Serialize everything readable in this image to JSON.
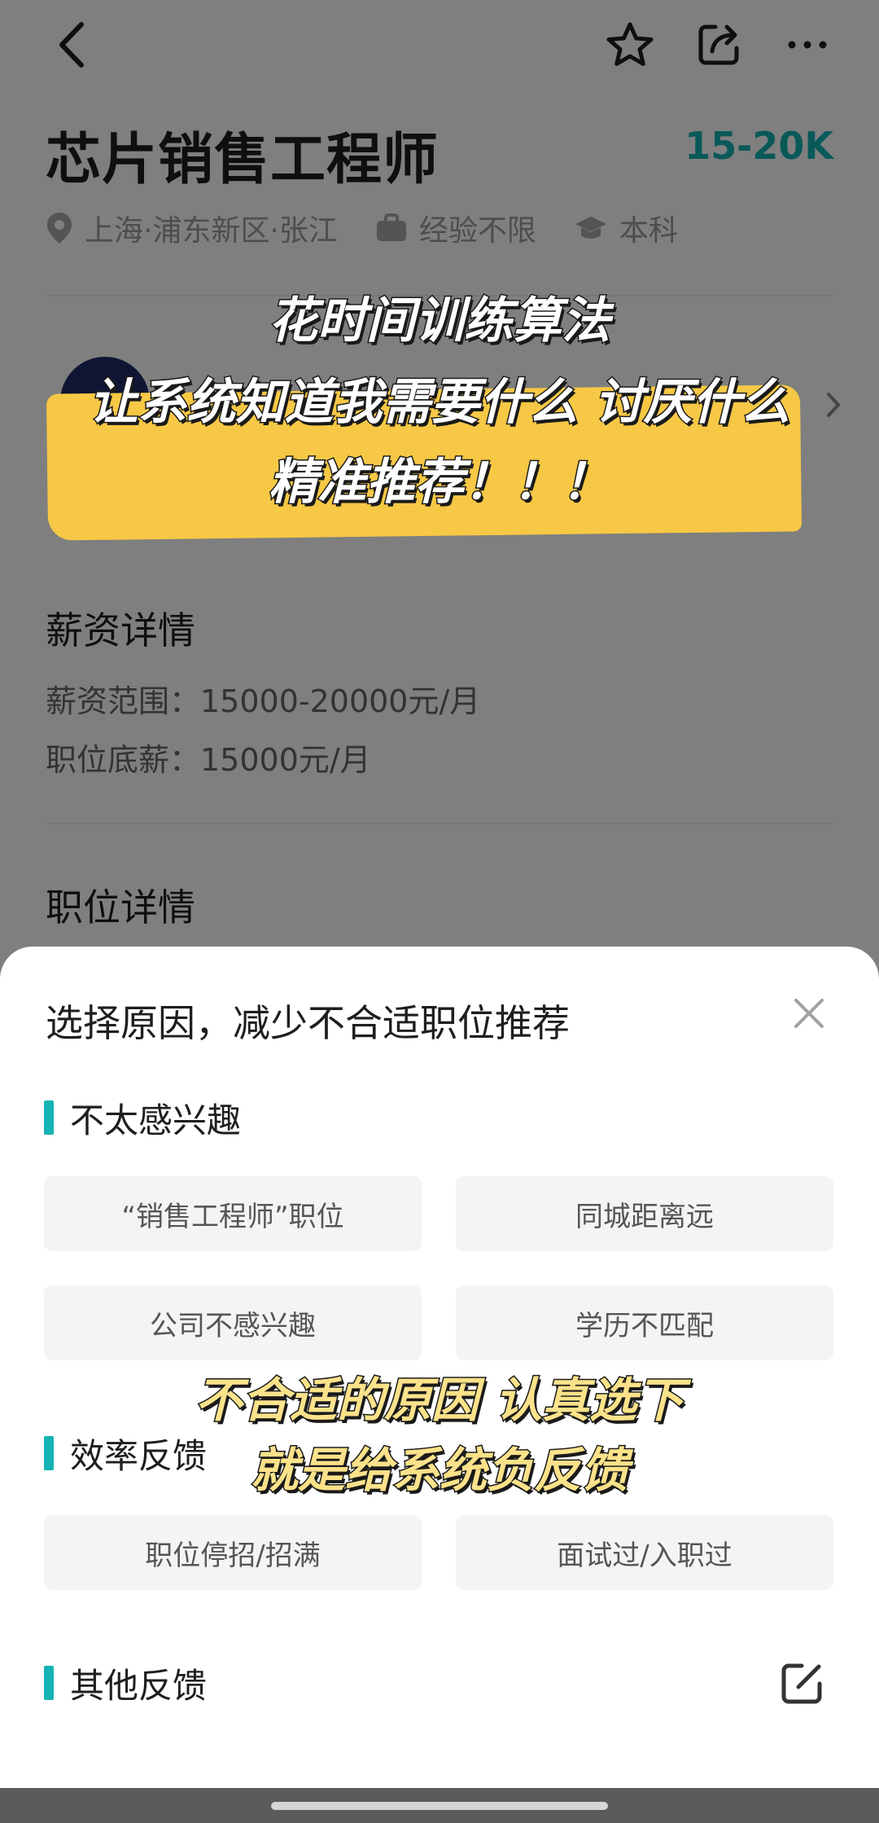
{
  "job": {
    "title": "芯片销售工程师",
    "salary": "15-20K",
    "location": "上海·浦东新区·张江",
    "experience": "经验不限",
    "education": "本科"
  },
  "salary_section": {
    "heading": "薪资详情",
    "range": "薪资范围：15000-20000元/月",
    "base": "职位底薪：15000元/月"
  },
  "details_section": {
    "heading": "职位详情"
  },
  "overlay_caption": {
    "line1": "花时间训练算法",
    "line2": "让系统知道我需要什么 讨厌什么",
    "line3": "精准推荐！！！",
    "mid_line1": "不合适的原因 认真选下",
    "mid_line2": "就是给系统负反馈"
  },
  "sheet": {
    "title": "选择原因，减少不合适职位推荐",
    "groups": [
      {
        "label": "不太感兴趣",
        "options": [
          "“销售工程师”职位",
          "同城距离远",
          "公司不感兴趣",
          "学历不匹配"
        ]
      },
      {
        "label": "效率反馈",
        "options": [
          "职位停招/招满",
          "面试过/入职过"
        ]
      },
      {
        "label": "其他反馈",
        "options": []
      }
    ]
  },
  "colors": {
    "accent": "#15b3b3",
    "highlight": "#f7c845"
  },
  "icons": {
    "back": "chevron-left-icon",
    "favorite": "star-icon",
    "share": "share-icon",
    "more": "more-icon",
    "close": "close-icon",
    "edit": "edit-icon"
  }
}
